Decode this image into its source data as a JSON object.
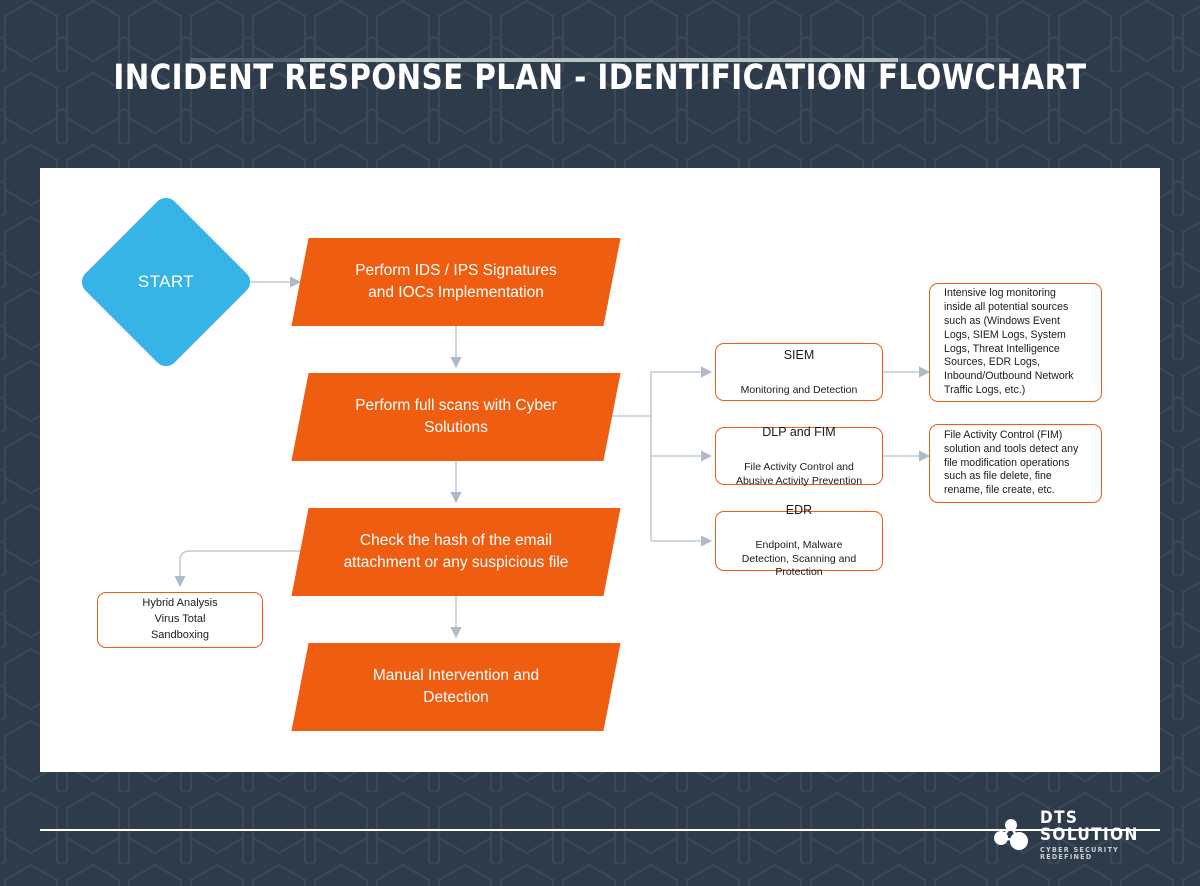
{
  "header": {
    "title": "INCIDENT RESPONSE PLAN - IDENTIFICATION FLOWCHART"
  },
  "footer": {
    "logo_name": "DTS SOLUTION",
    "logo_tagline": "CYBER SECURITY REDEFINED",
    "logo_icon": "molecule-nodes-icon"
  },
  "colors": {
    "background": "#2e3b4a",
    "canvas": "#ffffff",
    "orange": "#ef5d11",
    "start_blue": "#35b4e5",
    "connector": "#c3ccd6",
    "text_dark": "#1b1b1b",
    "title_rule_bright": "#b9c1c9"
  },
  "flow": {
    "start_node": {
      "label": "START",
      "shape": "diamond"
    },
    "process_nodes": [
      {
        "id": "ids-ips",
        "label": "Perform IDS / IPS Signatures\nand IOCs Implementation"
      },
      {
        "id": "full-scans",
        "label": "Perform full scans with Cyber\nSolutions"
      },
      {
        "id": "check-hash",
        "label": "Check the hash of the email\nattachment or any suspicious file"
      },
      {
        "id": "manual-intervention",
        "label": "Manual Intervention and\nDetection"
      }
    ],
    "solution_boxes": [
      {
        "id": "siem",
        "title": "SIEM",
        "subtitle": "Monitoring and Detection"
      },
      {
        "id": "dlp-fim",
        "title": "DLP and FIM",
        "subtitle": "File Activity Control and\nAbusive Activity Prevention"
      },
      {
        "id": "edr",
        "title": "EDR",
        "subtitle": "Endpoint, Malware\nDetection, Scanning and\nProtection"
      }
    ],
    "notes": [
      {
        "id": "siem-note",
        "text": "Intensive log monitoring\ninside all potential sources\nsuch as (Windows Event\nLogs, SIEM Logs, System\nLogs, Threat Intelligence\nSources, EDR Logs,\nInbound/Outbound Network\nTraffic Logs, etc.)"
      },
      {
        "id": "fim-note",
        "text": "File Activity Control (FIM)\nsolution and tools detect any\nfile modification operations\nsuch as file delete, fine\nrename, file create, etc."
      }
    ],
    "tools_box": {
      "id": "hybrid-analysis",
      "text": "Hybrid Analysis\nVirus Total\nSandboxing"
    }
  }
}
